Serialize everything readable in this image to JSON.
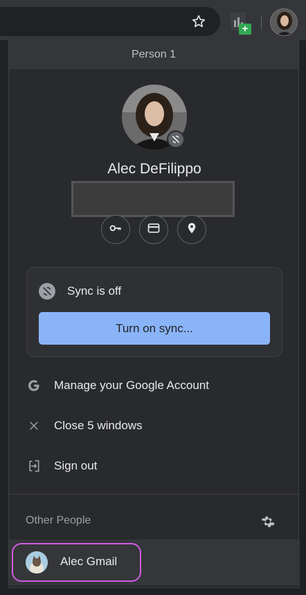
{
  "panel": {
    "header": "Person 1",
    "profile_name": "Alec DeFilippo"
  },
  "quick_actions": [
    "passwords-icon",
    "payment-methods-icon",
    "addresses-icon"
  ],
  "sync": {
    "status": "Sync is off",
    "button": "Turn on sync..."
  },
  "menu": {
    "manage_account": "Manage your Google Account",
    "close_windows": "Close 5 windows",
    "sign_out": "Sign out"
  },
  "other_people": {
    "title": "Other People",
    "people": [
      {
        "name": "Alec Gmail"
      }
    ]
  },
  "colors": {
    "accent": "#8ab4f8",
    "highlight": "#d05ce3"
  }
}
